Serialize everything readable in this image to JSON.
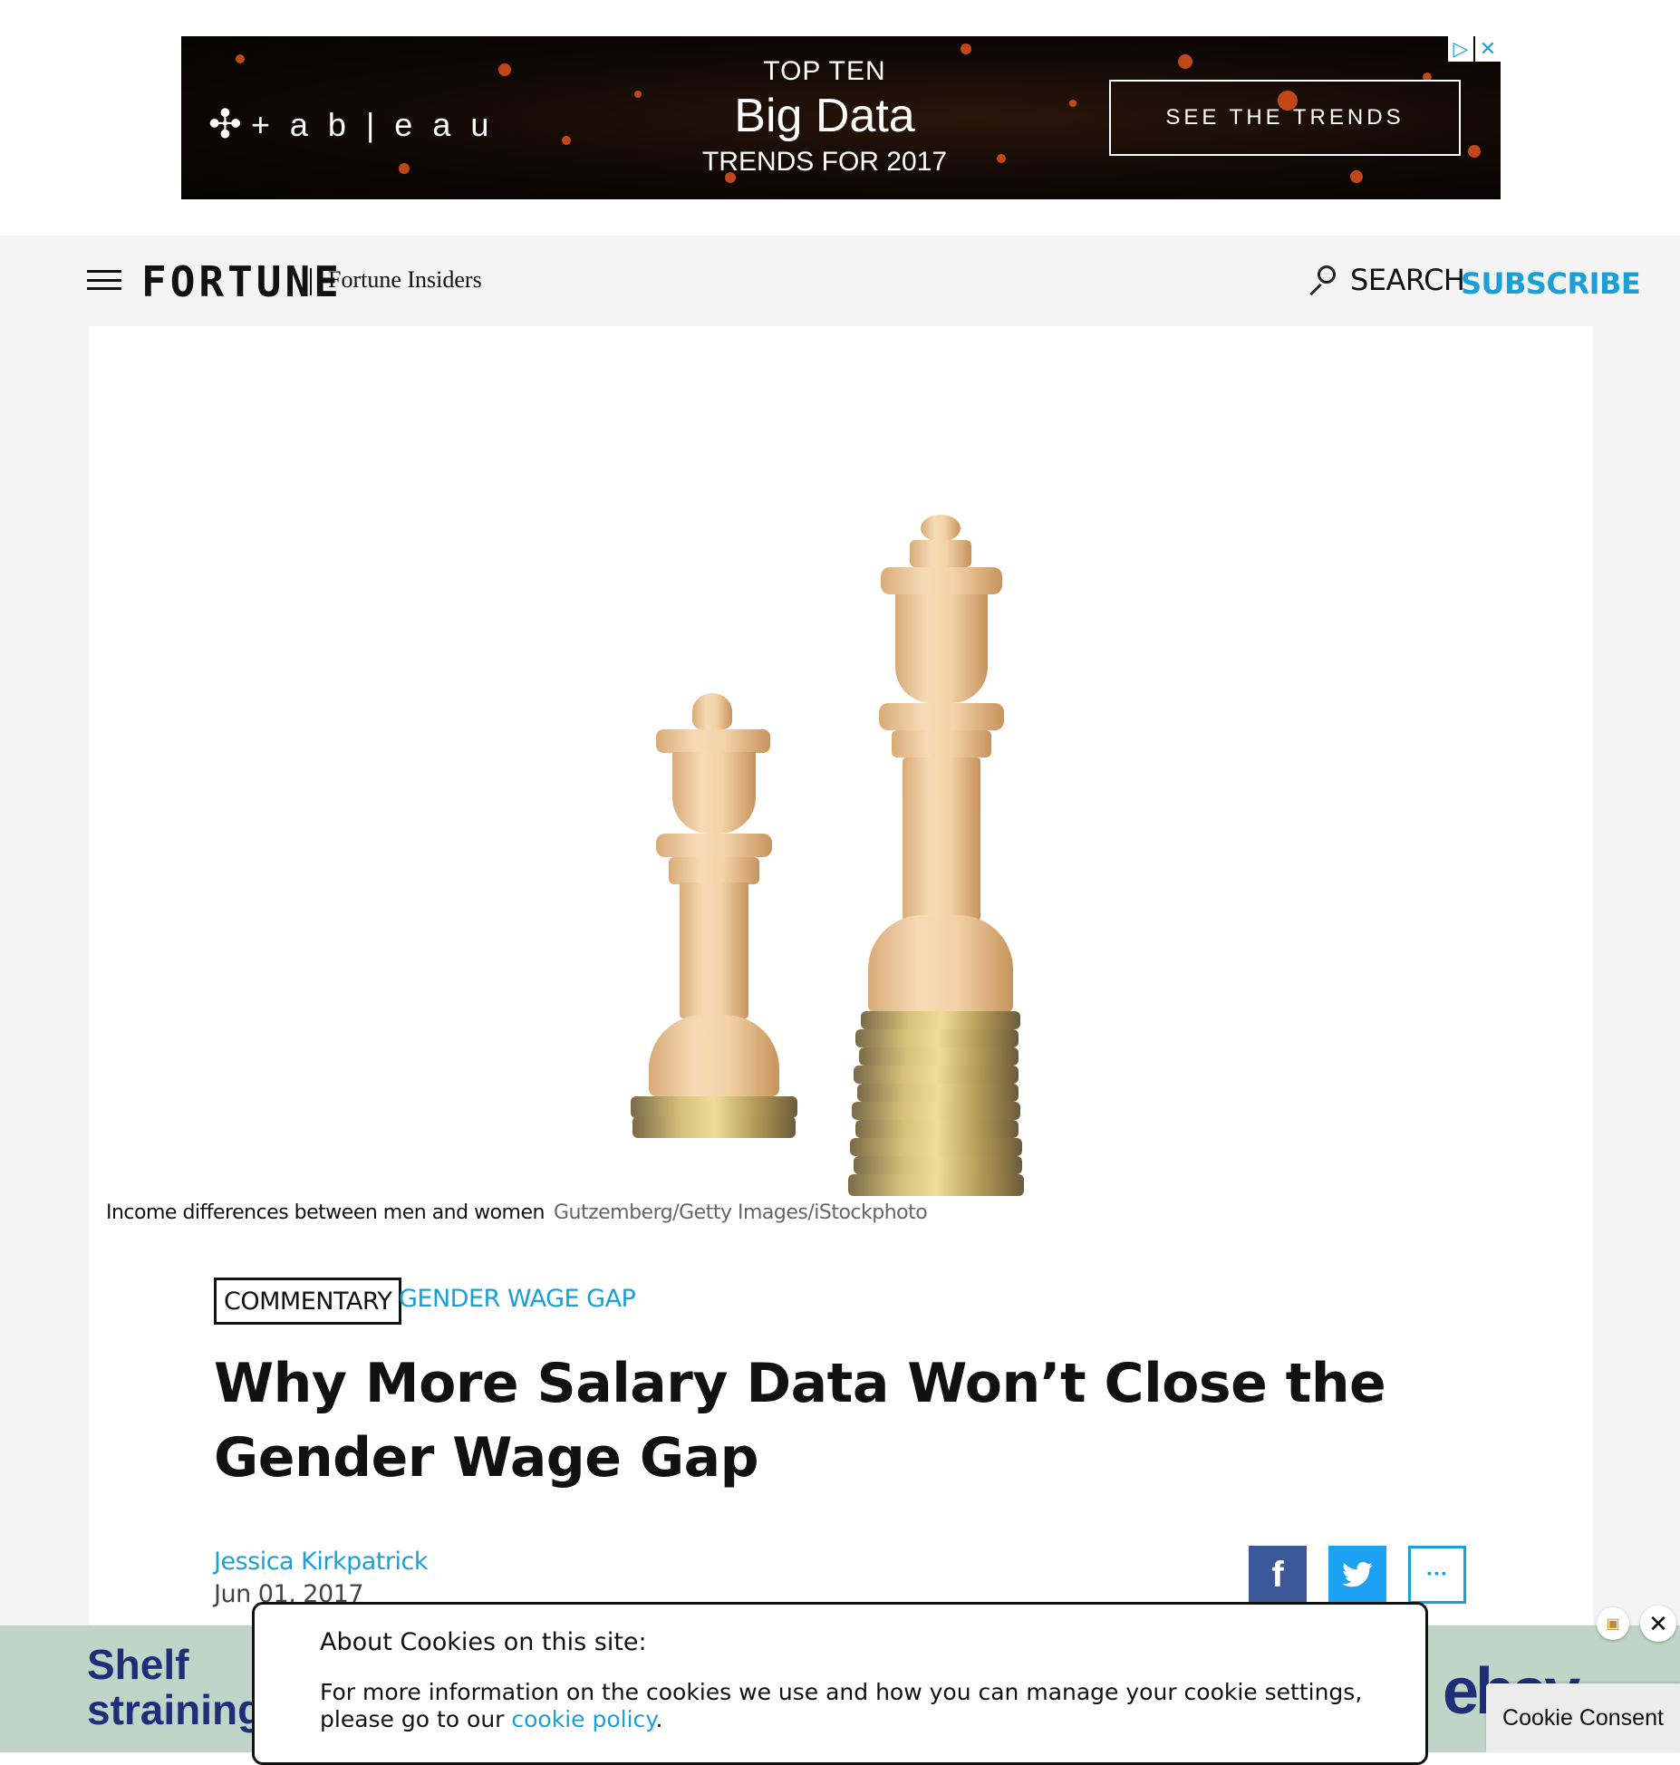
{
  "top_ad": {
    "logo_text": "+ a b | e a u",
    "line1": "TOP TEN",
    "line2": "Big Data",
    "line3": "TRENDS FOR 2017",
    "cta": "SEE THE TRENDS",
    "choices_icon": "ad-choices-icon",
    "close_icon": "close-icon"
  },
  "header": {
    "brand": "FORTUNE",
    "section": "Fortune Insiders",
    "search_label": "SEARCH",
    "subscribe_label": "SUBSCRIBE"
  },
  "article": {
    "image_caption": "Income differences between men and women",
    "image_credit": "Gutzemberg/Getty Images/iStockphoto",
    "tag_type": "COMMENTARY",
    "tag_topic": "GENDER WAGE GAP",
    "headline": "Why More Salary Data Won’t Close the Gender Wage Gap",
    "author": "Jessica Kirkpatrick",
    "date": "Jun 01, 2017",
    "share": {
      "facebook": "f",
      "more": "···"
    }
  },
  "bottom_ad": {
    "left_text_1": "Shelf",
    "left_text_2": "straining",
    "right_text": "ebay"
  },
  "cookie_dialog": {
    "title": "About Cookies on this site:",
    "body_prefix": "For more information on the cookies we use and how you can manage your cookie settings, please go to our ",
    "link_text": "cookie policy",
    "body_suffix": ".",
    "consent_tab": "Cookie Consent"
  },
  "colors": {
    "accent": "#1a9fd6",
    "facebook": "#3b5998",
    "twitter": "#1da1f2",
    "ad_bg": "#bfd5c7"
  }
}
